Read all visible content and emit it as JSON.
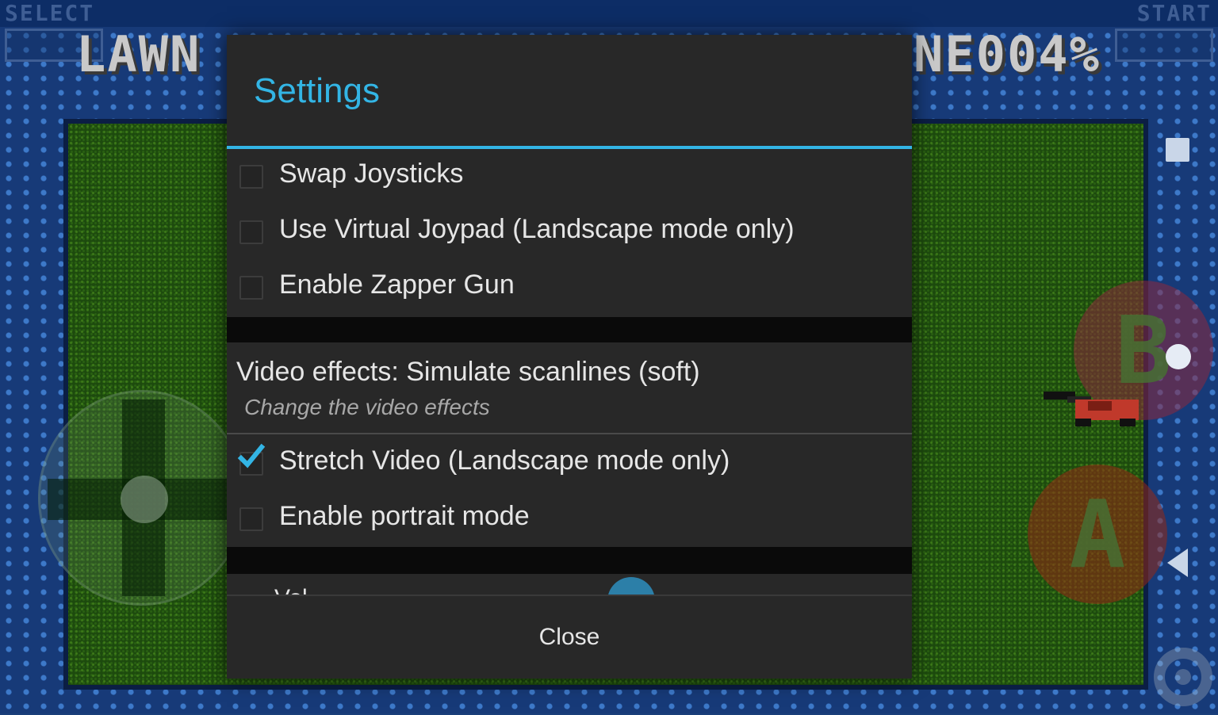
{
  "game": {
    "select_label": "SELECT",
    "start_label": "START",
    "score_left": "LAWN",
    "score_right": "NE004%",
    "b_button_label": "B",
    "a_button_label": "A"
  },
  "dialog": {
    "title": "Settings",
    "options_top": [
      {
        "label": "Swap Joysticks",
        "checked": false
      },
      {
        "label": "Use Virtual Joypad (Landscape mode only)",
        "checked": false
      },
      {
        "label": "Enable Zapper Gun",
        "checked": false
      }
    ],
    "video_effects": {
      "title": "Video effects: Simulate scanlines (soft)",
      "summary": "Change the video effects"
    },
    "options_bottom": [
      {
        "label": "Stretch Video (Landscape mode only)",
        "checked": true
      },
      {
        "label": "Enable portrait mode",
        "checked": false
      }
    ],
    "peek_label": "Vol",
    "close_label": "Close"
  },
  "colors": {
    "accent": "#33b5e5",
    "dialog_bg": "#282828",
    "text": "#e6e6e6"
  }
}
